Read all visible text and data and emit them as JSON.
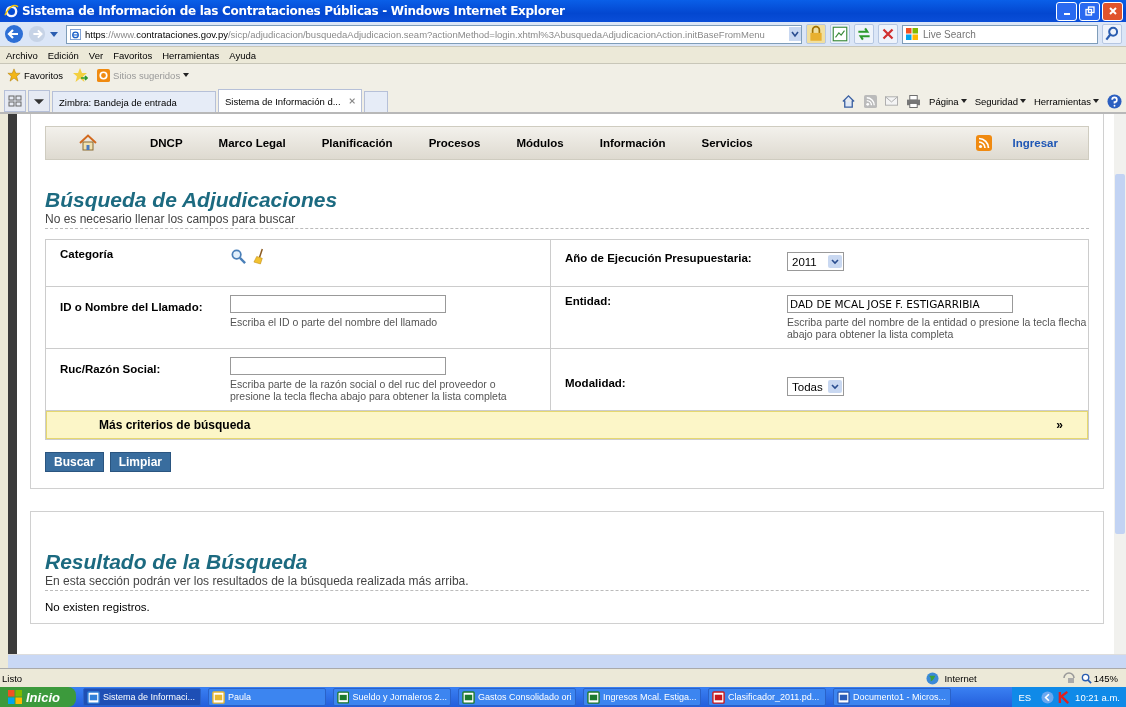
{
  "window": {
    "title": "Sistema de Información de las Contrataciones Públicas - Windows Internet Explorer"
  },
  "address_bar": {
    "scheme": "https",
    "prefix": "://www.",
    "domain": "contrataciones.gov.py",
    "path": "/sicp/adjudicacion/busquedaAdjudicacion.seam?actionMethod=login.xhtml%3AbusquedaAdjudicacionAction.initBaseFromMenu",
    "search_placeholder": "Live Search"
  },
  "menu_bar": [
    "Archivo",
    "Edición",
    "Ver",
    "Favoritos",
    "Herramientas",
    "Ayuda"
  ],
  "favorites_bar": {
    "favorites": "Favoritos",
    "suggested": "Sitios sugeridos"
  },
  "tabs": [
    {
      "label": "Zimbra: Bandeja de entrada",
      "selected": false
    },
    {
      "label": "Sistema de Información d...",
      "selected": true
    }
  ],
  "command_bar": [
    "Página",
    "Seguridad",
    "Herramientas"
  ],
  "nav": {
    "items": [
      "DNCP",
      "Marco Legal",
      "Planificación",
      "Procesos",
      "Módulos",
      "Información",
      "Servicios"
    ],
    "login": "Ingresar"
  },
  "search": {
    "title": "Búsqueda de Adjudicaciones",
    "subtitle": "No es necesario llenar los campos para buscar",
    "fields": [
      {
        "kind": "icons",
        "label": "Categoría"
      },
      {
        "kind": "select",
        "label": "Año de Ejecución Presupuestaria:",
        "value": "2011"
      },
      {
        "kind": "text",
        "label": "ID o Nombre del Llamado:",
        "hint": "Escriba el ID o parte del nombre del llamado"
      },
      {
        "kind": "text",
        "label": "Entidad:",
        "value": "DAD DE MCAL JOSE F. ESTIGARRIBIA",
        "hint": "Escriba parte del nombre de la entidad o presione la tecla flecha abajo para obtener la lista completa"
      },
      {
        "kind": "text",
        "label": "Ruc/Razón Social:",
        "hint": "Escriba parte de la razón social o del ruc del proveedor o presione la tecla flecha abajo para obtener la lista completa"
      },
      {
        "kind": "select",
        "label": "Modalidad:",
        "value": "Todas"
      }
    ],
    "more_criteria": "Más criterios de búsqueda",
    "more_toggle": "»",
    "buttons": [
      "Buscar",
      "Limpiar"
    ]
  },
  "results": {
    "title": "Resultado de la Búsqueda",
    "subtitle": "En esta sección podrán ver los resultados de la búsqueda realizada más arriba.",
    "empty": "No existen registros."
  },
  "status_bar": {
    "text": "Listo",
    "zone": "Internet",
    "zoom": "145%"
  },
  "taskbar": {
    "start": "Inicio",
    "items": [
      {
        "kind": "browser",
        "label": "Sistema de Informaci...",
        "selected": true
      },
      {
        "kind": "folder",
        "label": "Paula",
        "selected": false
      },
      {
        "kind": "spreadsheet",
        "label": "Sueldo y Jornaleros 2...",
        "selected": false
      },
      {
        "kind": "spreadsheet",
        "label": "Gastos Consolidado ori",
        "selected": false
      },
      {
        "kind": "spreadsheet",
        "label": "Ingresos Mcal. Estiga...",
        "selected": false
      },
      {
        "kind": "pdf",
        "label": "Clasificador_2011.pd...",
        "selected": false
      },
      {
        "kind": "document",
        "label": "Documento1 - Micros...",
        "selected": false
      }
    ],
    "language": "ES",
    "clock": "10:21 a.m."
  }
}
